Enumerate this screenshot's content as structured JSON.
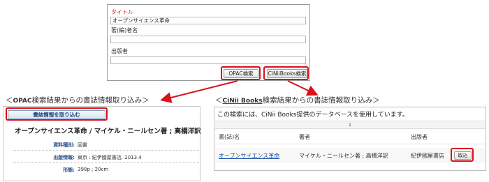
{
  "search_form": {
    "fields": [
      {
        "label": "タイトル",
        "value": "オープンサイエンス革命"
      },
      {
        "label": "著(編)者名",
        "value": ""
      },
      {
        "label": "出版者",
        "value": ""
      }
    ],
    "buttons": {
      "opac": "OPAC検索",
      "cinii": "CiNiiBooks検索"
    }
  },
  "sections": {
    "opac_heading_prefix": "＜",
    "opac_heading_brand": "OPAC",
    "opac_heading_rest": "検索結果からの書誌情報取り込み＞",
    "cinii_heading_prefix": "＜",
    "cinii_heading_brand": "CiNii Books",
    "cinii_heading_rest": "検索結果からの書誌情報取り込み＞"
  },
  "opac_result": {
    "import_button": "書誌情報を取り込む",
    "title_line": "オープンサイエンス革命 / マイケル・ニールセン著 ; 高橋洋訳",
    "details": [
      {
        "key": "資料種別:",
        "value": "図書"
      },
      {
        "key": "出版情報:",
        "value": "東京 : 紀伊國屋書店, 2013.4"
      },
      {
        "key": "形態:",
        "value": "398p ; 20cm"
      }
    ]
  },
  "cinii_result": {
    "note": "この検索には、CiNii Books提供のデータベースを使用しています。",
    "page": "1",
    "columns": [
      "書(誌)名",
      "著者",
      "出版者"
    ],
    "row": {
      "title": "オープンサイエンス革命",
      "author": "マイケル・ニールセン著 ; 高橋洋訳",
      "publisher": "紀伊國屋書店",
      "action": "取込"
    }
  },
  "colors": {
    "highlight": "#d9111b",
    "label_accent": "#c0392b",
    "link": "#1a4fa3"
  }
}
